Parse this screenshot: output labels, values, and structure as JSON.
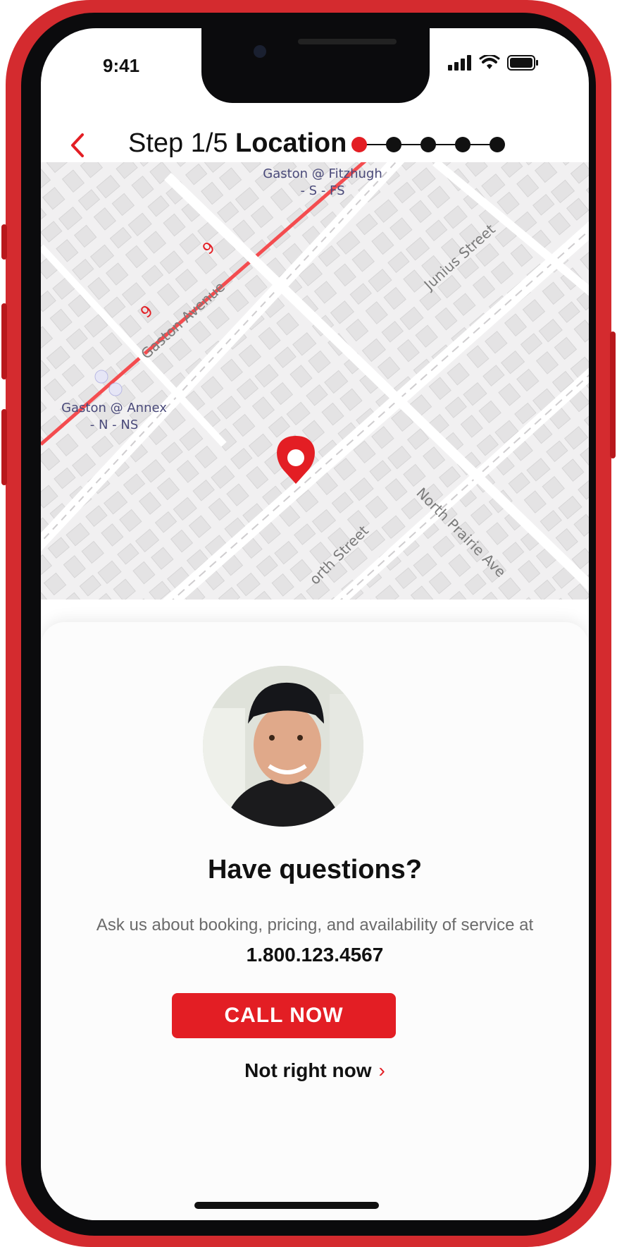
{
  "status_bar": {
    "time": "9:41"
  },
  "header": {
    "step_label": "Step 1/5",
    "title": "Location",
    "progress": {
      "current": 1,
      "total": 5
    }
  },
  "map": {
    "labels": {
      "fitzhugh_line1": "Gaston @ Fitzhugh",
      "fitzhugh_line2": "- S - FS",
      "annex_line1": "Gaston @ Annex",
      "annex_line2": "- N - NS",
      "gaston_avenue": "Gaston Avenue",
      "junius_street": "Junius Street",
      "north_street": "orth Street",
      "north_prairie": "North Prairie Ave",
      "route_top": "9",
      "route_bottom": "9"
    }
  },
  "sheet": {
    "title": "Have questions?",
    "body": "Ask us about booking, pricing, and availability of service at",
    "phone": "1.800.123.4567",
    "call_label": "CALL NOW",
    "dismiss_label": "Not right now"
  },
  "colors": {
    "accent": "#e31e24",
    "frame": "#d42b2f"
  }
}
